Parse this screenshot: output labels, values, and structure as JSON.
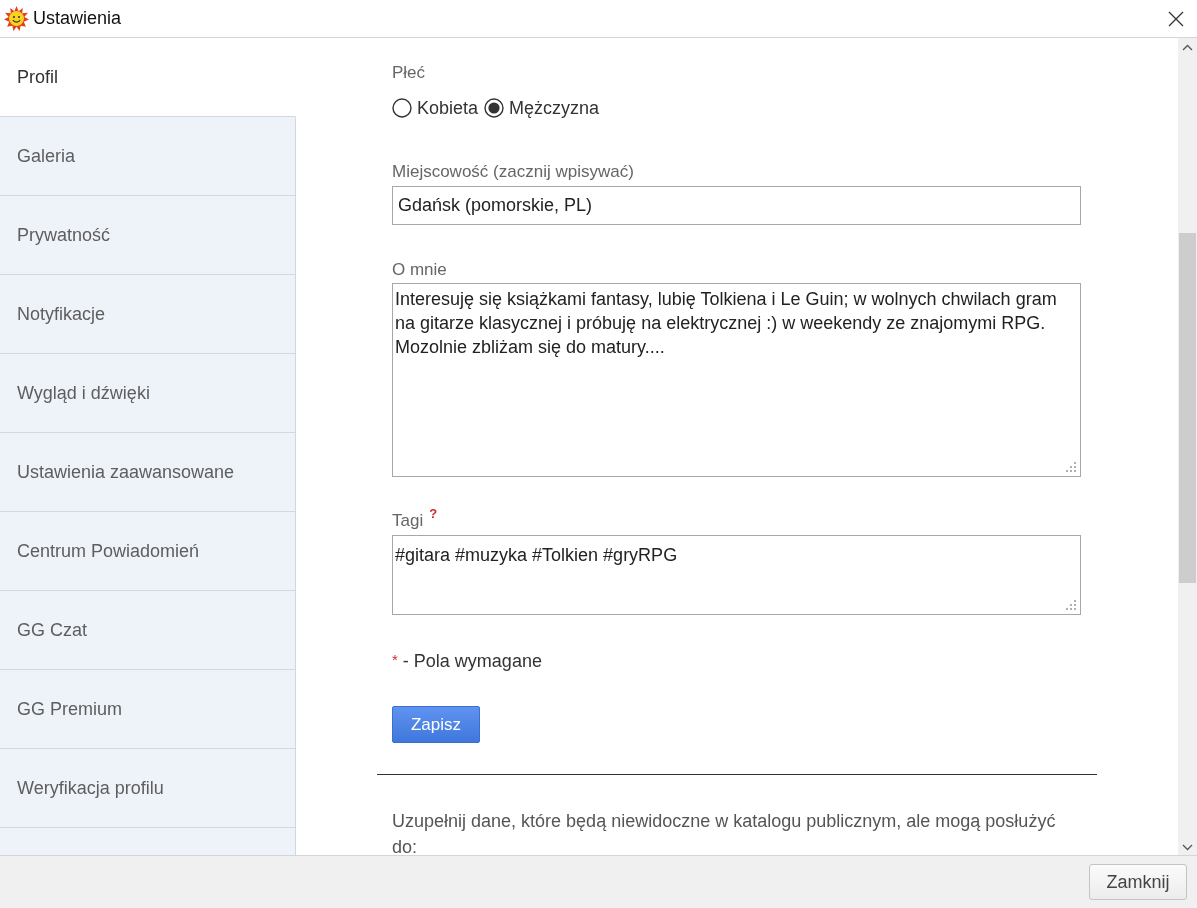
{
  "window": {
    "title": "Ustawienia"
  },
  "sidebar": {
    "items": [
      {
        "label": "Profil",
        "selected": true
      },
      {
        "label": "Galeria",
        "selected": false
      },
      {
        "label": "Prywatność",
        "selected": false
      },
      {
        "label": "Notyfikacje",
        "selected": false
      },
      {
        "label": "Wygląd i dźwięki",
        "selected": false
      },
      {
        "label": "Ustawienia zaawansowane",
        "selected": false
      },
      {
        "label": "Centrum Powiadomień",
        "selected": false
      },
      {
        "label": "GG Czat",
        "selected": false
      },
      {
        "label": "GG Premium",
        "selected": false
      },
      {
        "label": "Weryfikacja profilu",
        "selected": false
      }
    ]
  },
  "form": {
    "gender": {
      "label": "Płeć",
      "options": [
        {
          "label": "Kobieta",
          "selected": false
        },
        {
          "label": "Mężczyzna",
          "selected": true
        }
      ]
    },
    "city": {
      "label": "Miejscowość (zacznij wpisywać)",
      "value": "Gdańsk (pomorskie, PL)"
    },
    "about": {
      "label": "O mnie",
      "value": "Interesuję się książkami fantasy, lubię Tolkiena i Le Guin; w wolnych chwilach gram na gitarze klasycznej i próbuję na elektrycznej :) w weekendy ze znajomymi RPG. Mozolnie zbliżam się do matury...."
    },
    "tags": {
      "label": "Tagi",
      "help": "?",
      "value": "#gitara #muzyka #Tolkien #gryRPG"
    },
    "required_note": {
      "mark": "*",
      "text": "- Pola wymagane"
    },
    "save_button": "Zapisz",
    "private_info": "Uzupełnij dane, które będą niewidoczne w katalogu publicznym, ale mogą posłużyć do:"
  },
  "footer": {
    "buttons": [
      "Zamknij"
    ]
  }
}
